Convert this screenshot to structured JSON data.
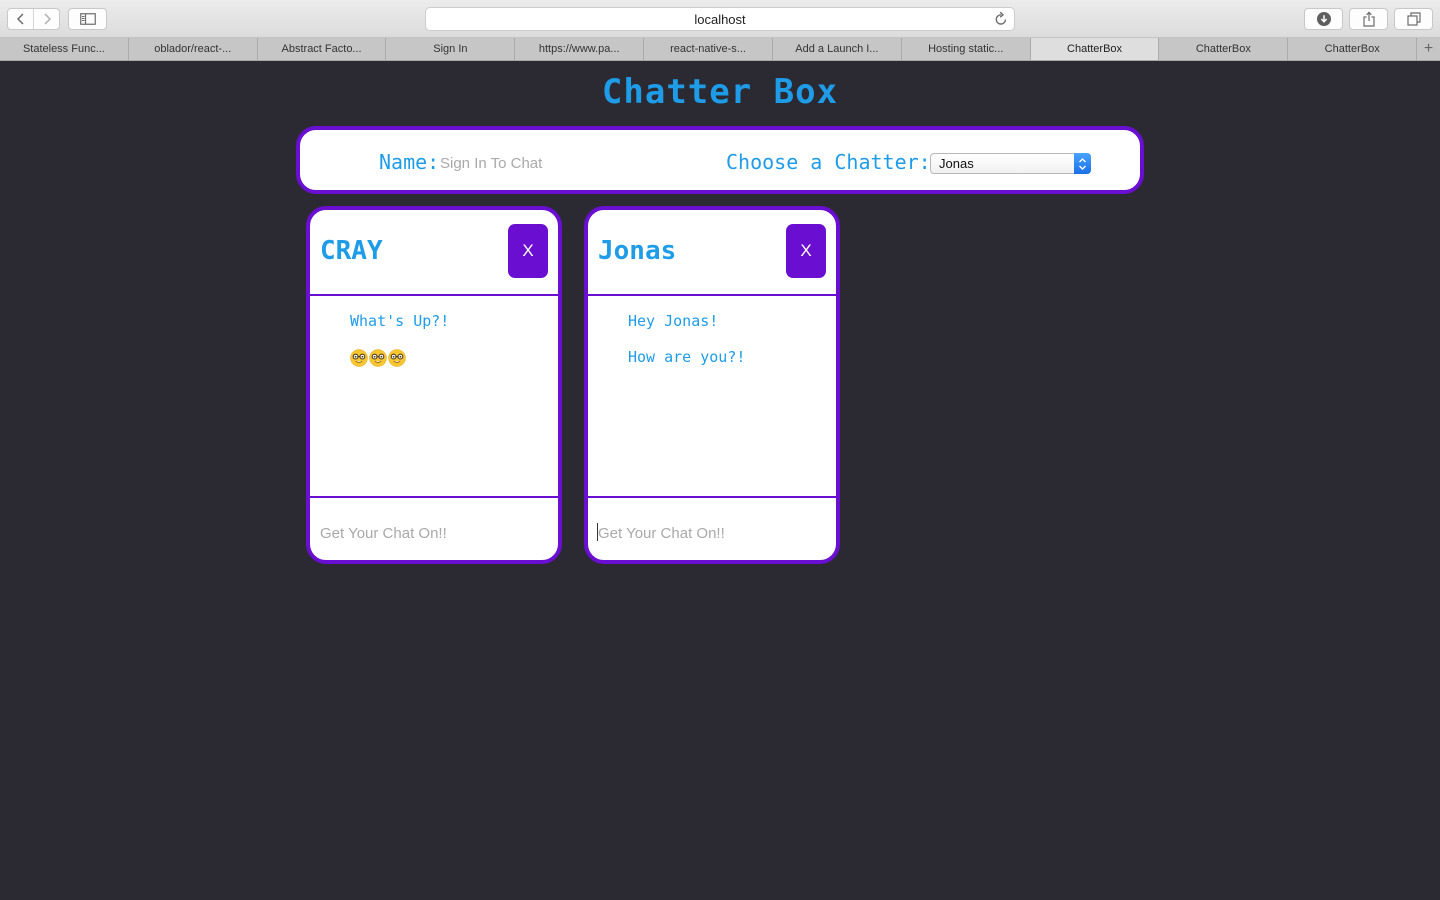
{
  "browser": {
    "address": "localhost",
    "tabs": [
      {
        "label": "Stateless Func...",
        "active": false
      },
      {
        "label": "oblador/react-...",
        "active": false
      },
      {
        "label": "Abstract Facto...",
        "active": false
      },
      {
        "label": "Sign In",
        "active": false
      },
      {
        "label": "https://www.pa...",
        "active": false
      },
      {
        "label": "react-native-s...",
        "active": false
      },
      {
        "label": "Add a Launch I...",
        "active": false
      },
      {
        "label": "Hosting static...",
        "active": false
      },
      {
        "label": "ChatterBox",
        "active": true
      },
      {
        "label": "ChatterBox",
        "active": false
      },
      {
        "label": "ChatterBox",
        "active": false
      }
    ],
    "new_tab_label": "+"
  },
  "page": {
    "title": "Chatter Box",
    "name_label": "Name:",
    "name_placeholder": "Sign In To Chat",
    "name_value": "",
    "chatter_label": "Choose a Chatter:",
    "chatter_selected": "Jonas"
  },
  "chats": [
    {
      "name": "CRAY",
      "close_label": "X",
      "messages": [
        "What's Up?!"
      ],
      "emoji_count": 3,
      "input_placeholder": "Get Your Chat On!!",
      "input_value": ""
    },
    {
      "name": "Jonas",
      "close_label": "X",
      "messages": [
        "Hey Jonas!",
        "How are you?!"
      ],
      "input_placeholder": "Get Your Chat On!!",
      "input_value": ""
    }
  ],
  "colors": {
    "background": "#2b2a33",
    "accent": "#6a0fd1",
    "text_blue": "#1e9ce8"
  },
  "icons": {
    "emoji": "nerd-face-icon"
  }
}
